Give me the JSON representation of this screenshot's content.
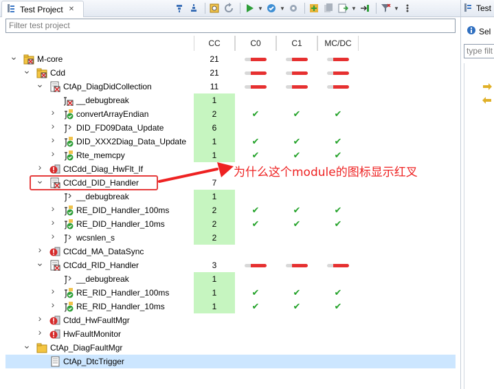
{
  "tab": {
    "title": "Test Project"
  },
  "filter": {
    "placeholder": "Filter test project"
  },
  "columns": [
    "CC",
    "C0",
    "C1",
    "MC/DC"
  ],
  "rows": [
    {
      "label": "M-core",
      "level": 0,
      "caret": "down",
      "icon": "module-folder-error",
      "cc": "21",
      "cc_green": false,
      "cov": [
        "bar",
        "bar",
        "bar"
      ]
    },
    {
      "label": "Cdd",
      "level": 1,
      "caret": "down",
      "icon": "folder-error",
      "cc": "21",
      "cc_green": false,
      "cov": [
        "bar",
        "bar",
        "bar"
      ]
    },
    {
      "label": "CtAp_DiagDidCollection",
      "level": 2,
      "caret": "down",
      "icon": "file-error",
      "cc": "11",
      "cc_green": false,
      "cov": [
        "bar",
        "bar",
        "bar"
      ]
    },
    {
      "label": "__debugbreak",
      "level": 3,
      "caret": "",
      "icon": "function-error",
      "cc": "1",
      "cc_green": true,
      "cov": [
        "",
        "",
        ""
      ]
    },
    {
      "label": "convertArrayEndian",
      "level": 3,
      "caret": "right",
      "icon": "function-ok",
      "cc": "2",
      "cc_green": true,
      "cov": [
        "check",
        "check",
        "check"
      ]
    },
    {
      "label": "DID_FD09Data_Update",
      "level": 3,
      "caret": "right",
      "icon": "function",
      "cc": "6",
      "cc_green": true,
      "cov": [
        "",
        "",
        ""
      ]
    },
    {
      "label": "DID_XXX2Diag_Data_Update",
      "level": 3,
      "caret": "right",
      "icon": "function-ok",
      "cc": "1",
      "cc_green": true,
      "cov": [
        "check",
        "check",
        "check"
      ]
    },
    {
      "label": "Rte_memcpy",
      "level": 3,
      "caret": "right",
      "icon": "function-ok",
      "cc": "1",
      "cc_green": true,
      "cov": [
        "check",
        "check",
        "check"
      ]
    },
    {
      "label": "CtCdd_Diag_HwFlt_If",
      "level": 2,
      "caret": "right",
      "icon": "module-error",
      "cc": "",
      "cc_green": false,
      "cov": [
        "",
        "",
        ""
      ]
    },
    {
      "label": "CtCdd_DID_Handler",
      "level": 2,
      "caret": "down",
      "icon": "file-error",
      "cc": "7",
      "cc_green": false,
      "cov": [
        "",
        "",
        ""
      ]
    },
    {
      "label": "__debugbreak",
      "level": 3,
      "caret": "",
      "icon": "function",
      "cc": "1",
      "cc_green": true,
      "cov": [
        "",
        "",
        ""
      ]
    },
    {
      "label": "RE_DID_Handler_100ms",
      "level": 3,
      "caret": "right",
      "icon": "function-ok",
      "cc": "2",
      "cc_green": true,
      "cov": [
        "check",
        "check",
        "check"
      ]
    },
    {
      "label": "RE_DID_Handler_10ms",
      "level": 3,
      "caret": "right",
      "icon": "function-ok",
      "cc": "2",
      "cc_green": true,
      "cov": [
        "check",
        "check",
        "check"
      ]
    },
    {
      "label": "wcsnlen_s",
      "level": 3,
      "caret": "right",
      "icon": "function",
      "cc": "2",
      "cc_green": true,
      "cov": [
        "",
        "",
        ""
      ]
    },
    {
      "label": "CtCdd_MA_DataSync",
      "level": 2,
      "caret": "right",
      "icon": "module-error",
      "cc": "",
      "cc_green": false,
      "cov": [
        "",
        "",
        ""
      ]
    },
    {
      "label": "CtCdd_RID_Handler",
      "level": 2,
      "caret": "down",
      "icon": "file-error",
      "cc": "3",
      "cc_green": false,
      "cov": [
        "bar",
        "bar",
        "bar"
      ]
    },
    {
      "label": "__debugbreak",
      "level": 3,
      "caret": "",
      "icon": "function",
      "cc": "1",
      "cc_green": true,
      "cov": [
        "",
        "",
        ""
      ]
    },
    {
      "label": "RE_RID_Handler_100ms",
      "level": 3,
      "caret": "right",
      "icon": "function-ok",
      "cc": "1",
      "cc_green": true,
      "cov": [
        "check",
        "check",
        "check"
      ]
    },
    {
      "label": "RE_RID_Handler_10ms",
      "level": 3,
      "caret": "right",
      "icon": "function-ok",
      "cc": "1",
      "cc_green": true,
      "cov": [
        "check",
        "check",
        "check"
      ]
    },
    {
      "label": "Ctdd_HwFaultMgr",
      "level": 2,
      "caret": "right",
      "icon": "module-error",
      "cc": "",
      "cc_green": false,
      "cov": [
        "",
        "",
        ""
      ]
    },
    {
      "label": "HwFaultMonitor",
      "level": 2,
      "caret": "right",
      "icon": "module-error",
      "cc": "",
      "cc_green": false,
      "cov": [
        "",
        "",
        ""
      ]
    },
    {
      "label": "CtAp_DiagFaultMgr",
      "level": 1,
      "caret": "down",
      "icon": "folder",
      "cc": "",
      "cc_green": false,
      "cov": [
        "",
        "",
        ""
      ]
    },
    {
      "label": "CtAp_DtcTrigger",
      "level": 2,
      "caret": "",
      "icon": "file",
      "cc": "",
      "cc_green": false,
      "cov": [
        "",
        "",
        ""
      ],
      "selected": true
    }
  ],
  "annotation": {
    "text": "为什么这个module的图标显示红叉"
  },
  "right_pane": {
    "tab_title": "Test",
    "select_label": "Sel",
    "filter_placeholder": "type filt"
  },
  "colors": {
    "cc_green": "#c6f5c0",
    "bar_red": "#e63030",
    "check": "#23a229",
    "annotation": "#ee2222",
    "selection": "#cce6ff"
  }
}
